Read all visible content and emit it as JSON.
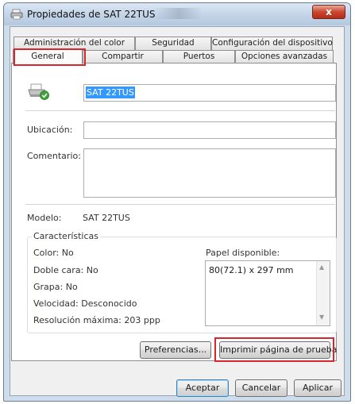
{
  "window": {
    "title": "Propiedades de SAT 22TUS",
    "close_glyph": "x"
  },
  "tabs": {
    "row_top": [
      "Administración del color",
      "Seguridad",
      "Configuración del dispositivo"
    ],
    "row_bottom": [
      "General",
      "Compartir",
      "Puertos",
      "Opciones avanzadas"
    ],
    "selected": "General"
  },
  "general": {
    "printer_name": "SAT 22TUS",
    "location_label": "Ubicación:",
    "location_value": "",
    "comment_label": "Comentario:",
    "comment_value": "",
    "model_label": "Modelo:",
    "model_value": "SAT 22TUS"
  },
  "features": {
    "legend": "Características",
    "color": "Color: No",
    "duplex": "Doble cara: No",
    "staple": "Grapa: No",
    "speed": "Velocidad: Desconocido",
    "resolution": "Resolución máxima: 203 ppp",
    "paper_label": "Papel disponible:",
    "paper_items": [
      "80(72.1) x 297 mm"
    ]
  },
  "buttons": {
    "preferences": "Preferencias...",
    "print_test": "Imprimir página de prueba",
    "ok": "Aceptar",
    "cancel": "Cancelar",
    "apply": "Aplicar"
  },
  "icons": {
    "title": "printer-icon",
    "printer": "printer-ready-icon",
    "scroll_up": "chevron-up-icon",
    "scroll_down": "chevron-down-icon"
  },
  "colors": {
    "highlight": "#d8262f",
    "selection": "#3399ff",
    "close": "#c9472f"
  }
}
